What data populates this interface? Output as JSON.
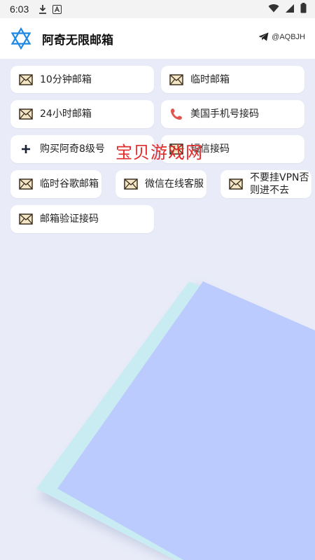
{
  "status_bar": {
    "time": "6:03"
  },
  "app_bar": {
    "title": "阿奇无限邮箱",
    "telegram_handle": "@AQBJH"
  },
  "menu": {
    "ten_min_mail": "10分钟邮箱",
    "temp_mail": "临时邮箱",
    "mail_24h": "24小时邮箱",
    "us_phone_sms": "美国手机号接码",
    "buy_qq_level8": "购买阿奇8级号",
    "sms_verify": "短信接码",
    "temp_gmail": "临时谷歌邮箱",
    "wechat_support": "微信在线客服",
    "no_vpn": "不要挂VPN否则进不去",
    "mail_verify": "邮箱验证接码"
  },
  "watermark": "宝贝游戏网"
}
